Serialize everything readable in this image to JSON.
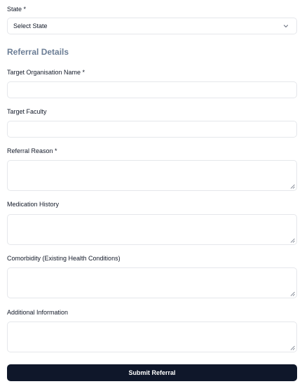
{
  "form": {
    "state": {
      "label": "State *",
      "value": "Select State"
    },
    "section_title": "Referral Details",
    "fields": {
      "target_org": {
        "label": "Target Organisation Name *",
        "value": ""
      },
      "target_faculty": {
        "label": "Target Faculty",
        "value": ""
      },
      "referral_reason": {
        "label": "Referral Reason *",
        "value": ""
      },
      "medication_history": {
        "label": "Medication History",
        "value": ""
      },
      "comorbidity": {
        "label": "Comorbidity (Existing Health Conditions)",
        "value": ""
      },
      "additional_info": {
        "label": "Additional Information",
        "value": ""
      }
    },
    "submit_label": "Submit Referral"
  },
  "icons": {
    "select_chevron": "chevron-down-icon",
    "resize_grip": "resize-grip-icon"
  },
  "colors": {
    "section_title": "#6b7d95",
    "submit_bg": "#0f172a",
    "border": "#e5e7eb"
  }
}
